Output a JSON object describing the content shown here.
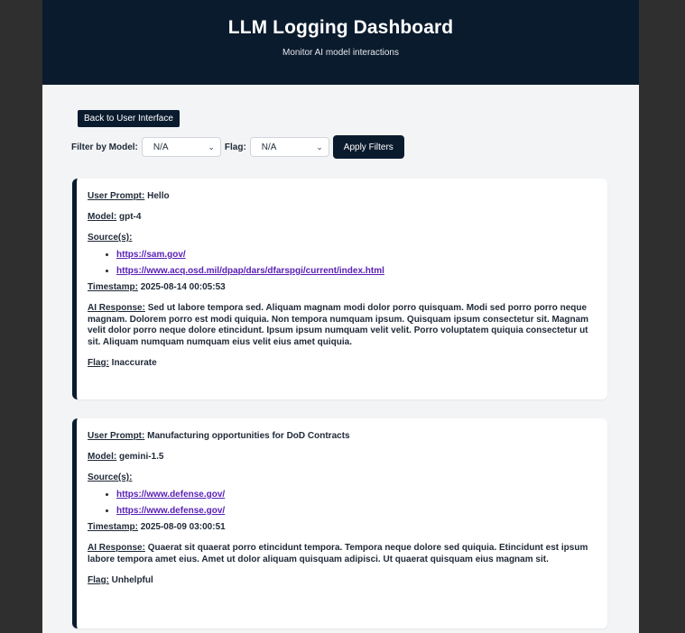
{
  "header": {
    "title": "LLM Logging Dashboard",
    "subtitle": "Monitor AI model interactions"
  },
  "controls": {
    "back_label": "Back to User Interface",
    "filter_model_label": "Filter by Model:",
    "model_value": "N/A",
    "flag_label": "Flag:",
    "flag_value": "N/A",
    "apply_label": "Apply Filters"
  },
  "labels": {
    "user_prompt": "User Prompt:",
    "model": "Model:",
    "sources": "Source(s):",
    "timestamp": "Timestamp:",
    "ai_response": "AI Response:",
    "flag": "Flag:"
  },
  "logs": [
    {
      "prompt": "Hello",
      "model": "gpt-4",
      "sources": [
        "https://sam.gov/",
        "https://www.acq.osd.mil/dpap/dars/dfarspgi/current/index.html"
      ],
      "timestamp": "2025-08-14 00:05:53",
      "response": "Sed ut labore tempora sed. Aliquam magnam modi dolor porro quisquam. Modi sed porro porro neque magnam. Dolorem porro est modi quiquia. Non tempora numquam ipsum. Quisquam ipsum consectetur sit. Magnam velit dolor porro neque dolore etincidunt. Ipsum ipsum numquam velit velit. Porro voluptatem quiquia consectetur ut sit. Aliquam numquam numquam eius velit eius amet quiquia.",
      "flag": "Inaccurate"
    },
    {
      "prompt": "Manufacturing opportunities for DoD Contracts",
      "model": "gemini-1.5",
      "sources": [
        "https://www.defense.gov/",
        "https://www.defense.gov/"
      ],
      "timestamp": "2025-08-09 03:00:51",
      "response": "Quaerat sit quaerat porro etincidunt tempora. Tempora neque dolore sed quiquia. Etincidunt est ipsum labore tempora amet eius. Amet ut dolor aliquam quisquam adipisci. Ut quaerat quisquam eius magnam sit.",
      "flag": "Unhelpful"
    }
  ]
}
